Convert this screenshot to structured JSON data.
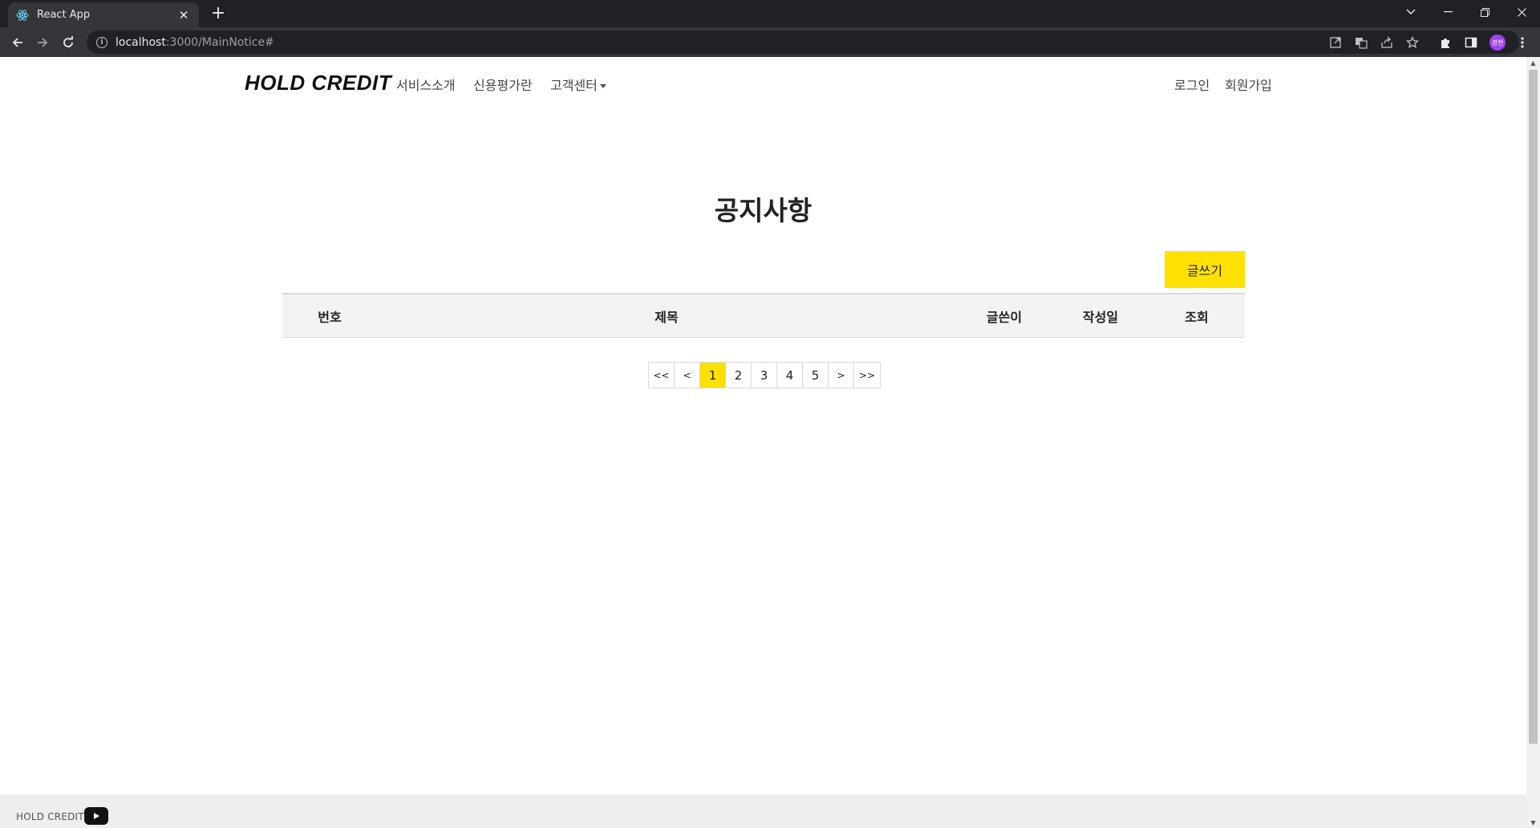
{
  "browser": {
    "tab_title": "React App",
    "url_host": "localhost",
    "url_path": ":3000/MainNotice#",
    "profile_initials": "경현"
  },
  "header": {
    "logo": "HOLD CREDIT",
    "nav": {
      "service_intro": "서비스소개",
      "credit_rating": "신용평가란",
      "customer_center": "고객센터"
    },
    "login": "로그인",
    "signup": "회원가입"
  },
  "page": {
    "title": "공지사항",
    "write_button": "글쓰기"
  },
  "board": {
    "columns": {
      "number": "번호",
      "title": "제목",
      "author": "글쓴이",
      "date": "작성일",
      "views": "조회"
    },
    "rows": []
  },
  "pagination": {
    "first": "<<",
    "prev": "<",
    "pages": [
      "1",
      "2",
      "3",
      "4",
      "5"
    ],
    "current": "1",
    "next": ">",
    "last": ">>"
  },
  "footer": {
    "label": "HOLD CREDIT"
  },
  "colors": {
    "accent": "#ffe100",
    "chrome_dark": "#202124",
    "chrome_toolbar": "#35363a"
  }
}
